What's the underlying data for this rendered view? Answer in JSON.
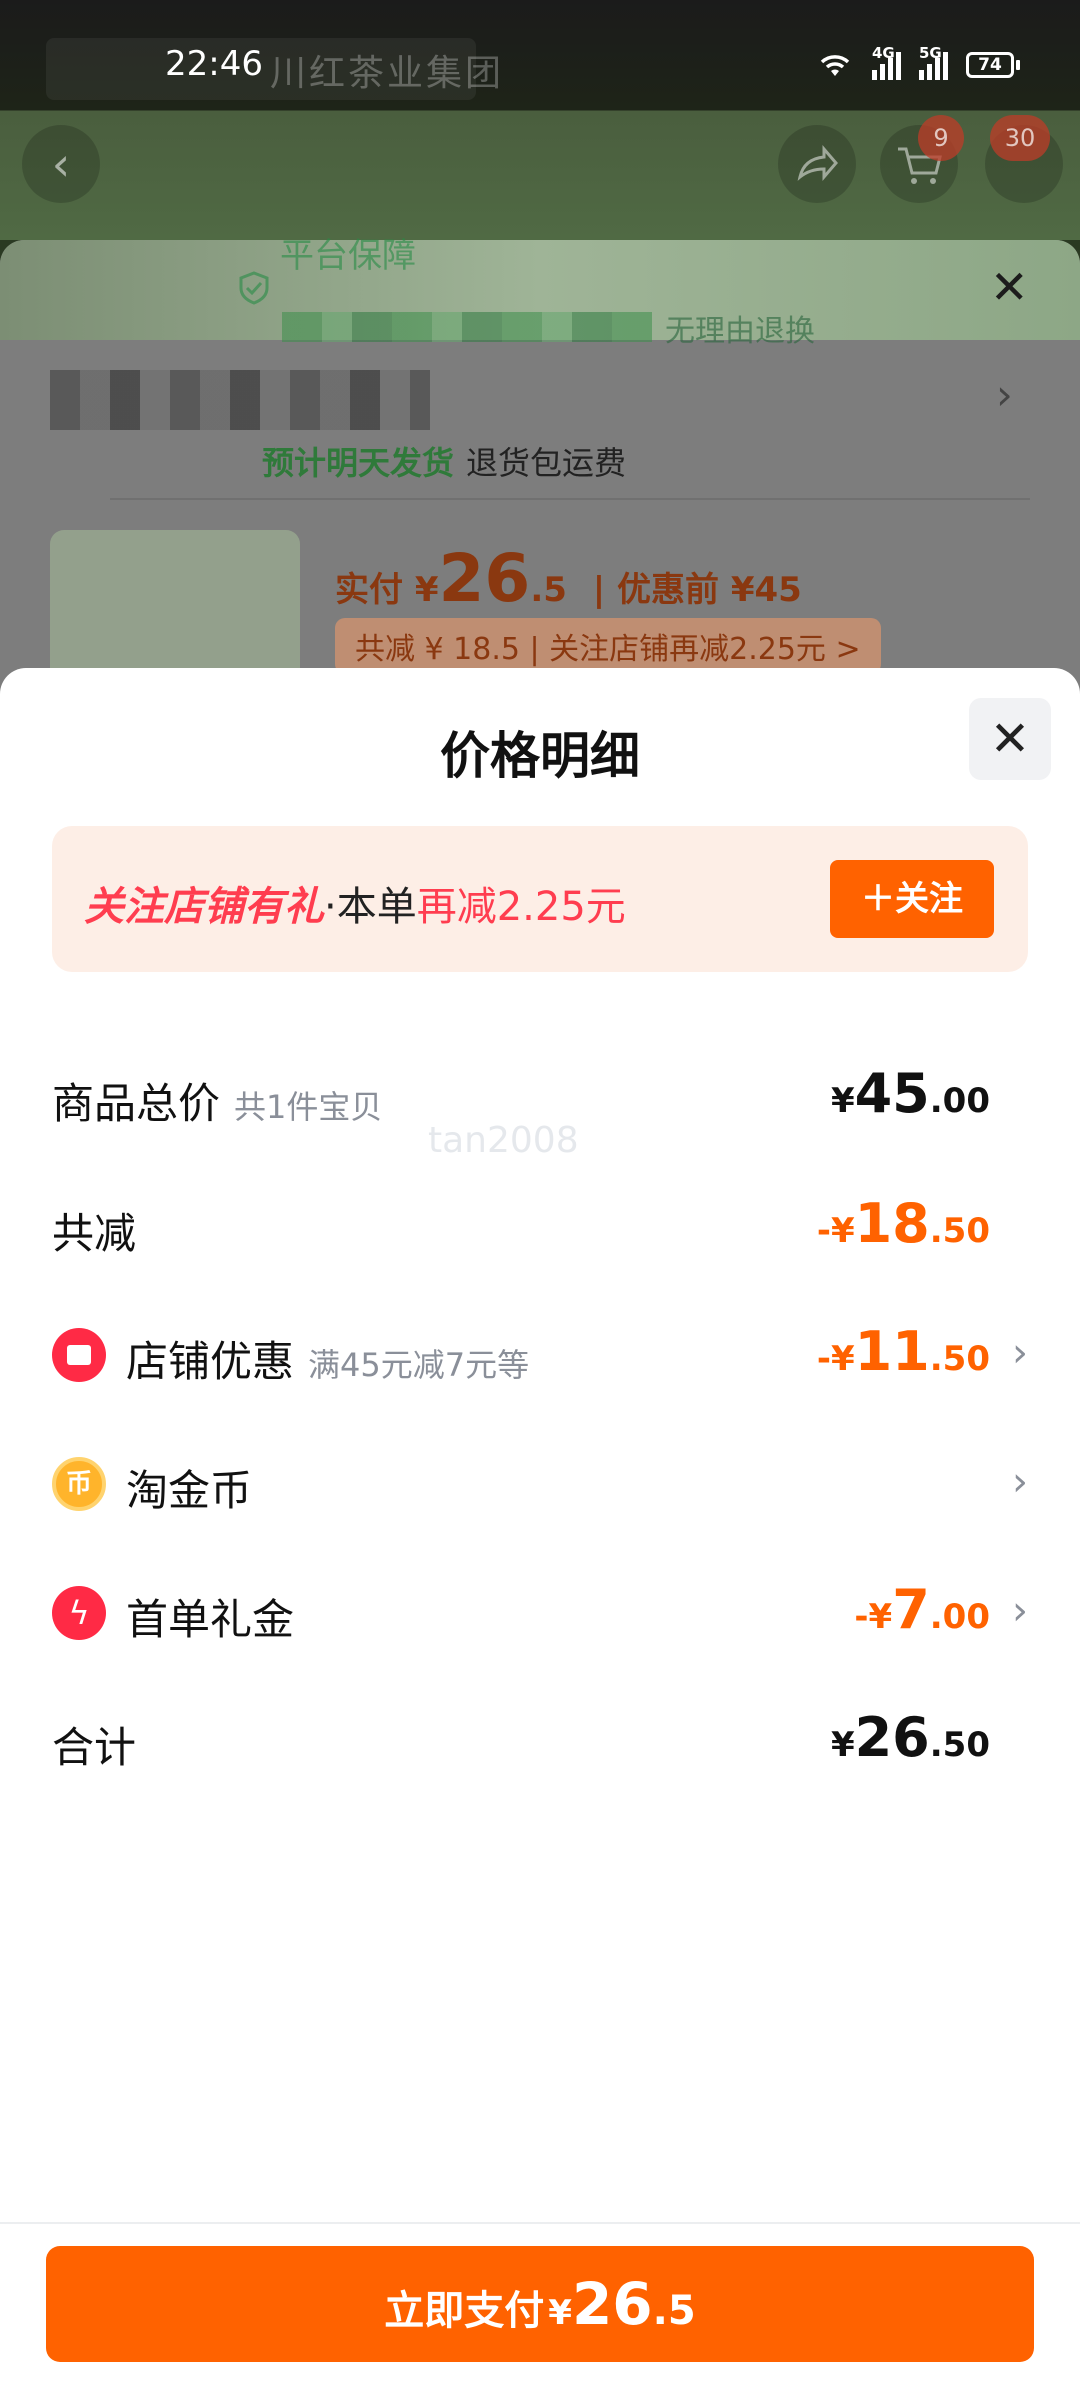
{
  "status_bar": {
    "time": "22:46",
    "network_1": "4G",
    "network_2": "5G",
    "battery": "74"
  },
  "background": {
    "brand_name": "川红茶业集团",
    "cart_badge": "9",
    "more_badge": "30",
    "guarantee_title": "平台保障",
    "guarantee_sub": "无理由退换",
    "ship_estimate": "预计明天发货",
    "ship_note": "退货包运费",
    "price_prefix": "实付 ¥",
    "price_big": "26",
    "price_small": ".5",
    "price_before": "| 优惠前 ¥45",
    "discount_pill": "共减 ¥ 18.5 | 关注店铺再减2.25元 >"
  },
  "sheet": {
    "title": "价格明细",
    "promo": {
      "italic": "关注店铺有礼",
      "dot": "·",
      "plain": "本单",
      "red": "再减2.25元",
      "button": "＋关注"
    },
    "rows": [
      {
        "label": "商品总价",
        "sub": "共1件宝贝",
        "sym": "¥",
        "int": "45",
        "dec": ".00"
      },
      {
        "label": "共减",
        "sym": "-¥",
        "int": "18",
        "dec": ".50"
      },
      {
        "label": "店铺优惠",
        "sub": "满45元减7元等",
        "sym": "-¥",
        "int": "11",
        "dec": ".50",
        "icon": "store-icon"
      },
      {
        "label": "淘金币",
        "icon": "coin-icon",
        "icon_glyph": "币"
      },
      {
        "label": "首单礼金",
        "sym": "-¥",
        "int": "7",
        "dec": ".00",
        "icon": "bolt-icon"
      },
      {
        "label": "合计",
        "sym": "¥",
        "int": "26",
        "dec": ".50"
      }
    ],
    "watermark": "tan2008",
    "pay": {
      "label": "立即支付",
      "sym": "¥",
      "int": "26",
      "dec": ".5"
    }
  },
  "colors": {
    "accent_orange": "#ff6200",
    "promo_red": "#ff3d4f",
    "promo_bg": "#fdeee6"
  }
}
